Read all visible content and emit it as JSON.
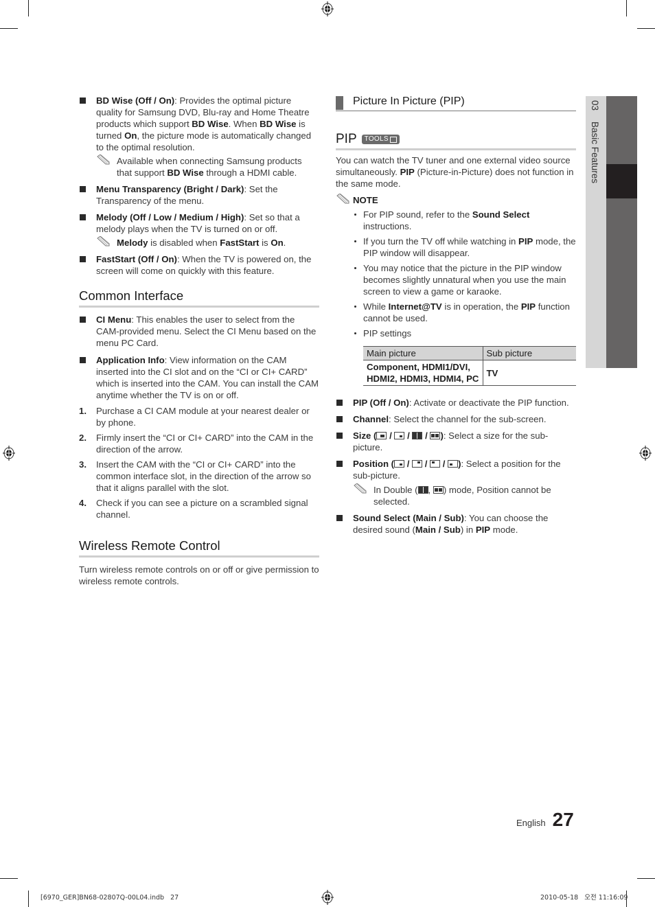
{
  "left": {
    "items_top": [
      {
        "type": "bullet",
        "bold": "BD Wise (Off / On)",
        "text": ": Provides the optimal picture quality for Samsung DVD, Blu-ray and Home Theatre products which support ",
        "b2": "BD Wise",
        "t2": ". When ",
        "b3": "BD Wise",
        "t3": " is turned ",
        "b4": "On",
        "t4": ", the picture mode is automatically changed to the optimal resolution."
      },
      {
        "type": "note",
        "text": "Available when connecting Samsung products that support ",
        "bold": "BD Wise",
        "text2": " through a HDMI cable."
      },
      {
        "type": "bullet",
        "bold": "Menu Transparency (Bright / Dark)",
        "text": ": Set the Transparency of the menu."
      },
      {
        "type": "bullet",
        "bold": "Melody (Off / Low / Medium / High)",
        "text": ": Set so that a melody plays when the TV is turned on or off."
      },
      {
        "type": "note",
        "bold": "Melody",
        "text": " is disabled when ",
        "bold2": "FastStart",
        "text2": " is ",
        "bold3": "On",
        "text3": "."
      },
      {
        "type": "bullet",
        "bold": "FastStart (Off / On)",
        "text": ": When the TV is powered on, the screen will come on quickly with this feature."
      }
    ],
    "common_interface": {
      "title": "Common Interface",
      "bullets": [
        {
          "bold": "CI Menu",
          "text": ": This enables the user to select from the CAM-provided menu. Select the CI Menu based on the menu PC Card."
        },
        {
          "bold": "Application Info",
          "text": ": View information on the CAM inserted into the CI slot and on the “CI or CI+ CARD” which is inserted into the CAM. You can install the CAM anytime whether the TV is on or off."
        }
      ],
      "steps": [
        {
          "num": "1.",
          "text": "Purchase a CI CAM module at your nearest dealer or by phone."
        },
        {
          "num": "2.",
          "text": "Firmly insert the “CI or CI+ CARD” into the CAM in the direction of the arrow."
        },
        {
          "num": "3.",
          "text": "Insert the CAM with the “CI or CI+ CARD” into the common interface slot, in the direction of the arrow so that it aligns parallel with the slot."
        },
        {
          "num": "4.",
          "text": "Check if you can see a picture on a scrambled signal channel."
        }
      ]
    },
    "wireless": {
      "title": "Wireless Remote Control",
      "text": "Turn wireless remote controls on or off or give permission to wireless remote controls."
    }
  },
  "right": {
    "banner": "Picture In Picture (PIP)",
    "pip_title": "PIP",
    "tools_label": "TOOLS",
    "intro_1": "You can watch the TV tuner and one external video source simultaneously. ",
    "intro_bold": "PIP",
    "intro_2": " (Picture-in-Picture) does not function in the same mode.",
    "note_label": "NOTE",
    "notes": {
      "n1a": "For PIP sound, refer to the ",
      "n1b": "Sound Select",
      "n1c": " instructions.",
      "n2a": "If you turn the TV off while watching in ",
      "n2b": "PIP",
      "n2c": " mode, the PIP window will disappear.",
      "n3": "You may notice that the picture in the PIP window becomes slightly unnatural when you use the main screen to view a game or karaoke.",
      "n4a": "While ",
      "n4b": "Internet@TV",
      "n4c": " is in operation, the ",
      "n4d": "PIP",
      "n4e": " function cannot be used.",
      "n5": "PIP settings"
    },
    "table": {
      "headers": [
        "Main picture",
        "Sub picture"
      ],
      "rows": [
        [
          "Component, HDMI1/DVI, HDMI2, HDMI3, HDMI4, PC",
          "TV"
        ]
      ]
    },
    "items": {
      "pip_bold": "PIP (Off / On)",
      "pip_text": ": Activate or deactivate the PIP function.",
      "channel_bold": "Channel",
      "channel_text": ": Select the channel for the sub-screen.",
      "size_bold": "Size (",
      "size_close": ")",
      "size_text": ": Select a size for the sub-picture.",
      "position_bold": "Position (",
      "position_close": ")",
      "position_text": ": Select a position for the sub-picture.",
      "double_note_a": "In Double (",
      "double_note_sep": ", ",
      "double_note_b": ") mode, Position cannot be selected.",
      "sound_bold": "Sound Select (Main / Sub)",
      "sound_text": ": You can choose the desired sound (",
      "sound_b2": "Main / Sub",
      "sound_t2": ") in ",
      "sound_b3": "PIP",
      "sound_t3": " mode.",
      "slash": " / "
    }
  },
  "side_tab": {
    "number": "03",
    "label": "Basic Features",
    "colors": {
      "light": "#d6d6d6",
      "dark": "#666464",
      "active": "#231f20"
    }
  },
  "footer": {
    "language": "English",
    "page_number": "27",
    "file_slug": "[6970_GER]BN68-02807Q-00L04.indb   27",
    "date_slug": "2010-05-18   오전 11:16:09"
  }
}
